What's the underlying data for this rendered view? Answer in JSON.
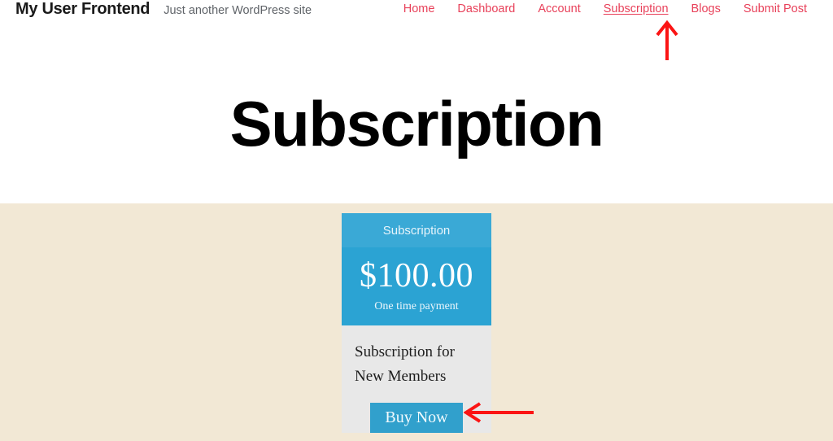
{
  "header": {
    "site_title": "My User Frontend",
    "tagline": "Just another WordPress site",
    "nav": [
      {
        "label": "Home",
        "active": false
      },
      {
        "label": "Dashboard",
        "active": false
      },
      {
        "label": "Account",
        "active": false
      },
      {
        "label": "Subscription",
        "active": true
      },
      {
        "label": "Blogs",
        "active": false
      },
      {
        "label": "Submit Post",
        "active": false
      }
    ],
    "nav_link_color": "#e8415a"
  },
  "main": {
    "page_title": "Subscription",
    "band_background_color": "#f2e8d5"
  },
  "subscription_card": {
    "header_title": "Subscription",
    "price": "$100.00",
    "price_note": "One time payment",
    "description": "Subscription for New Members",
    "buy_label": "Buy Now",
    "header_color": "#2ba3d3",
    "body_color": "#e8e8e8",
    "button_color": "#31a0cc"
  },
  "annotations": {
    "arrow_color": "#fb1414",
    "arrow_up_target": "Subscription nav link",
    "arrow_left_target": "Buy Now button"
  }
}
